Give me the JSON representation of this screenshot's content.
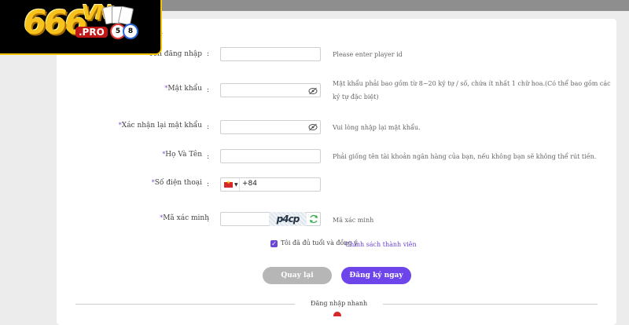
{
  "brand": {
    "logo_number": "666",
    "logo_letters": "VN",
    "logo_suffix": ".PRO",
    "ball_1": "5",
    "ball_2": "8"
  },
  "heading_fragment": "n",
  "form": {
    "username": {
      "label": "Tên đăng nhập",
      "value": "",
      "hint": "Please enter player id"
    },
    "password": {
      "label": "Mật khẩu",
      "value": "",
      "hint_line1": "Mật khẩu phải bao gồm từ 8~20 ký tự / số, chứa ít nhất 1 chữ hoa.(Có thể bao gồm các",
      "hint_line2": "ký tự đặc biệt)"
    },
    "confirm_password": {
      "label": "Xác nhận lại mật khẩu",
      "value": "",
      "hint": "Vui lòng nhập lại mật khẩu."
    },
    "full_name": {
      "label": "Họ Và Tên",
      "value": "",
      "hint": "Phải giống tên tài khoản ngân hàng của bạn, nếu không bạn sẽ không thể rút tiền."
    },
    "phone": {
      "label": "Số điện thoại",
      "country_code": "+84",
      "value": ""
    },
    "captcha": {
      "label": "Mã xác minh",
      "value": "",
      "image_text": "p4cp",
      "hint": "Mã xác minh"
    },
    "colon": ":",
    "required_mark": "*"
  },
  "agreement": {
    "text": "Tôi đã đủ tuổi và đồng ý",
    "link": "Chính sách thành viên",
    "checked": true
  },
  "buttons": {
    "back": "Quay lại",
    "register": "Đăng ký ngay"
  },
  "quick_login": "Đăng nhập nhanh",
  "colors": {
    "accent": "#6d45ea",
    "button_gray": "#b6b6b6",
    "logo_gold": "#f6c21b"
  }
}
